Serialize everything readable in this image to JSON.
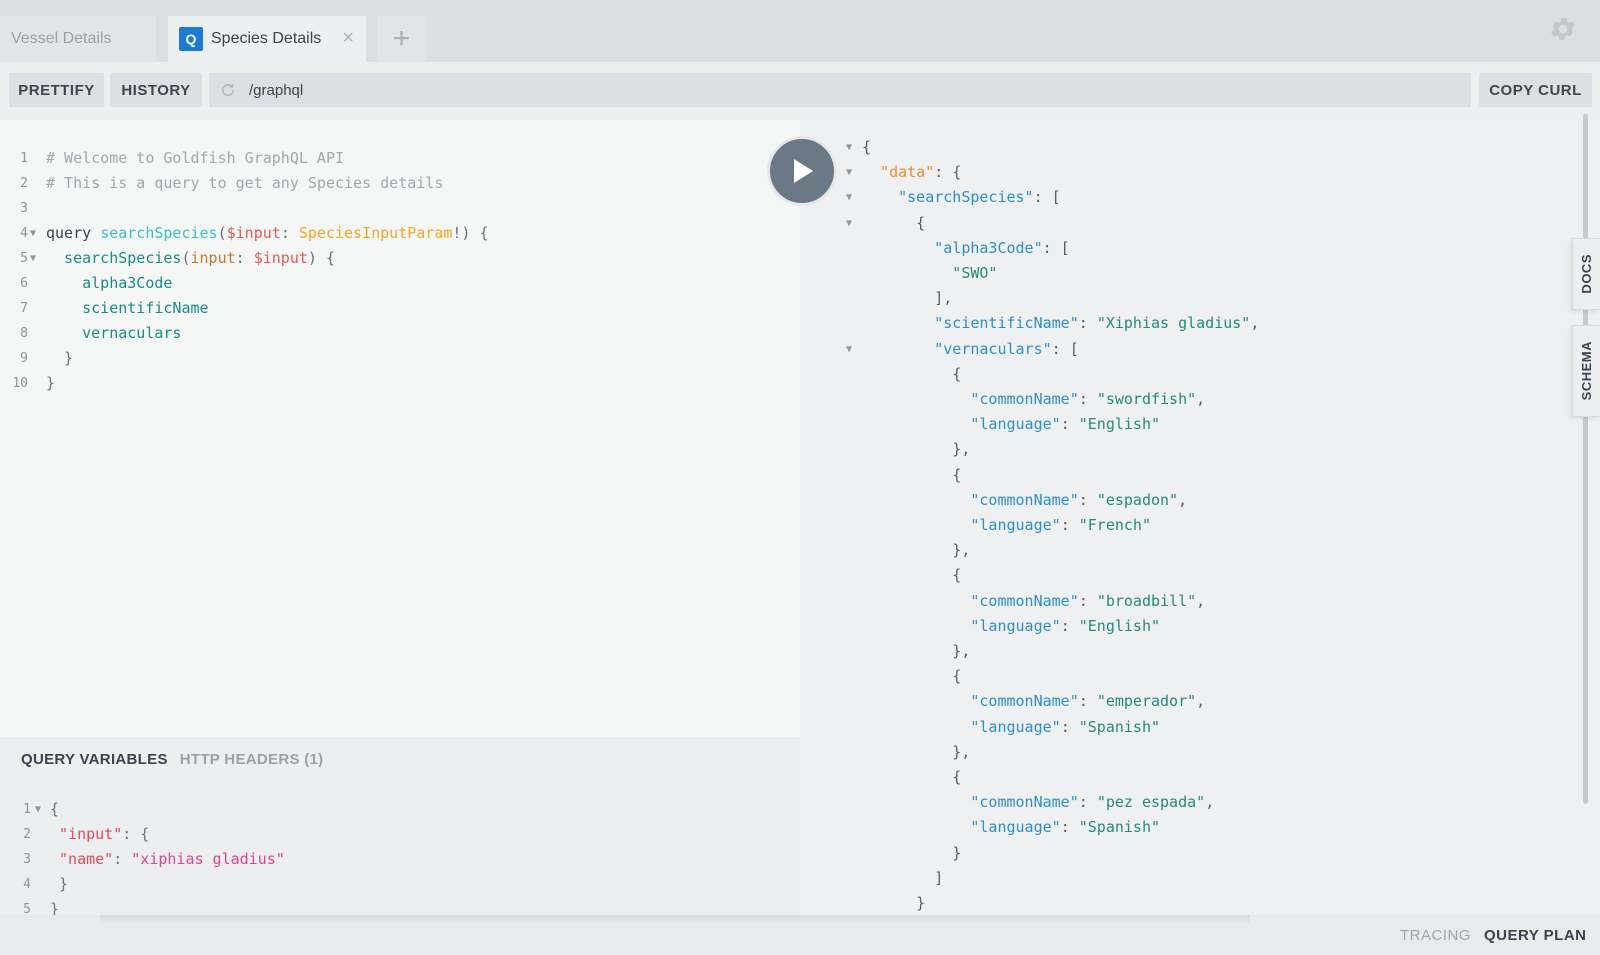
{
  "tabs": [
    {
      "label": "Vessel Details",
      "active": false
    },
    {
      "label": "Species Details",
      "active": true,
      "icon_letter": "Q"
    }
  ],
  "toolbar": {
    "prettify": "PRETTIFY",
    "history": "HISTORY",
    "url": "/graphql",
    "copy_curl": "COPY CURL"
  },
  "query_lines": [
    [
      {
        "t": "# Welcome to Goldfish GraphQL API",
        "c": "c-comment"
      }
    ],
    [
      {
        "t": "# This is a query to get any Species details",
        "c": "c-comment"
      }
    ],
    [],
    [
      {
        "t": "query ",
        "c": "c-kw"
      },
      {
        "t": "searchSpecies",
        "c": "c-def"
      },
      {
        "t": "(",
        "c": "c-punc"
      },
      {
        "t": "$input",
        "c": "c-var"
      },
      {
        "t": ": ",
        "c": "c-punc"
      },
      {
        "t": "SpeciesInputParam",
        "c": "c-type"
      },
      {
        "t": "!) {",
        "c": "c-punc"
      }
    ],
    [
      {
        "t": "  searchSpecies",
        "c": "c-field"
      },
      {
        "t": "(",
        "c": "c-punc"
      },
      {
        "t": "input",
        "c": "c-attr"
      },
      {
        "t": ": ",
        "c": "c-punc"
      },
      {
        "t": "$input",
        "c": "c-var"
      },
      {
        "t": ") {",
        "c": "c-punc"
      }
    ],
    [
      {
        "t": "    alpha3Code",
        "c": "c-field"
      }
    ],
    [
      {
        "t": "    scientificName",
        "c": "c-field"
      }
    ],
    [
      {
        "t": "    vernaculars",
        "c": "c-field"
      }
    ],
    [
      {
        "t": "  }",
        "c": "c-punc"
      }
    ],
    [
      {
        "t": "}",
        "c": "c-punc"
      }
    ]
  ],
  "query_folds": [
    4,
    5
  ],
  "variables": {
    "tab_active": "QUERY VARIABLES",
    "tab_inactive": "HTTP HEADERS (1)",
    "lines": [
      [
        {
          "t": "{",
          "c": "c-punc"
        }
      ],
      [
        {
          "t": " \"input\"",
          "c": "c-jkey"
        },
        {
          "t": ": {",
          "c": "c-punc"
        }
      ],
      [
        {
          "t": " \"name\"",
          "c": "c-jkey"
        },
        {
          "t": ": ",
          "c": "c-punc"
        },
        {
          "t": "\"xiphias gladius\"",
          "c": "c-jstr"
        }
      ],
      [
        {
          "t": " }",
          "c": "c-punc"
        }
      ],
      [
        {
          "t": "}",
          "c": "c-punc"
        }
      ]
    ],
    "folds": [
      1
    ]
  },
  "result_lines": [
    [
      {
        "t": "{",
        "c": "r-punc"
      }
    ],
    [
      {
        "t": "  \"data\"",
        "c": "r-key-data"
      },
      {
        "t": ": {",
        "c": "r-punc"
      }
    ],
    [
      {
        "t": "    \"searchSpecies\"",
        "c": "r-key"
      },
      {
        "t": ": [",
        "c": "r-punc"
      }
    ],
    [
      {
        "t": "      {",
        "c": "r-punc"
      }
    ],
    [
      {
        "t": "        \"alpha3Code\"",
        "c": "r-key"
      },
      {
        "t": ": [",
        "c": "r-punc"
      }
    ],
    [
      {
        "t": "          \"SWO\"",
        "c": "r-str"
      }
    ],
    [
      {
        "t": "        ],",
        "c": "r-punc"
      }
    ],
    [
      {
        "t": "        \"scientificName\"",
        "c": "r-key"
      },
      {
        "t": ": ",
        "c": "r-punc"
      },
      {
        "t": "\"Xiphias gladius\"",
        "c": "r-str"
      },
      {
        "t": ",",
        "c": "r-punc"
      }
    ],
    [
      {
        "t": "        \"vernaculars\"",
        "c": "r-key"
      },
      {
        "t": ": [",
        "c": "r-punc"
      }
    ],
    [
      {
        "t": "          {",
        "c": "r-punc"
      }
    ],
    [
      {
        "t": "            \"commonName\"",
        "c": "r-key"
      },
      {
        "t": ": ",
        "c": "r-punc"
      },
      {
        "t": "\"swordfish\"",
        "c": "r-str"
      },
      {
        "t": ",",
        "c": "r-punc"
      }
    ],
    [
      {
        "t": "            \"language\"",
        "c": "r-key"
      },
      {
        "t": ": ",
        "c": "r-punc"
      },
      {
        "t": "\"English\"",
        "c": "r-str"
      }
    ],
    [
      {
        "t": "          },",
        "c": "r-punc"
      }
    ],
    [
      {
        "t": "          {",
        "c": "r-punc"
      }
    ],
    [
      {
        "t": "            \"commonName\"",
        "c": "r-key"
      },
      {
        "t": ": ",
        "c": "r-punc"
      },
      {
        "t": "\"espadon\"",
        "c": "r-str"
      },
      {
        "t": ",",
        "c": "r-punc"
      }
    ],
    [
      {
        "t": "            \"language\"",
        "c": "r-key"
      },
      {
        "t": ": ",
        "c": "r-punc"
      },
      {
        "t": "\"French\"",
        "c": "r-str"
      }
    ],
    [
      {
        "t": "          },",
        "c": "r-punc"
      }
    ],
    [
      {
        "t": "          {",
        "c": "r-punc"
      }
    ],
    [
      {
        "t": "            \"commonName\"",
        "c": "r-key"
      },
      {
        "t": ": ",
        "c": "r-punc"
      },
      {
        "t": "\"broadbill\"",
        "c": "r-str"
      },
      {
        "t": ",",
        "c": "r-punc"
      }
    ],
    [
      {
        "t": "            \"language\"",
        "c": "r-key"
      },
      {
        "t": ": ",
        "c": "r-punc"
      },
      {
        "t": "\"English\"",
        "c": "r-str"
      }
    ],
    [
      {
        "t": "          },",
        "c": "r-punc"
      }
    ],
    [
      {
        "t": "          {",
        "c": "r-punc"
      }
    ],
    [
      {
        "t": "            \"commonName\"",
        "c": "r-key"
      },
      {
        "t": ": ",
        "c": "r-punc"
      },
      {
        "t": "\"emperador\"",
        "c": "r-str"
      },
      {
        "t": ",",
        "c": "r-punc"
      }
    ],
    [
      {
        "t": "            \"language\"",
        "c": "r-key"
      },
      {
        "t": ": ",
        "c": "r-punc"
      },
      {
        "t": "\"Spanish\"",
        "c": "r-str"
      }
    ],
    [
      {
        "t": "          },",
        "c": "r-punc"
      }
    ],
    [
      {
        "t": "          {",
        "c": "r-punc"
      }
    ],
    [
      {
        "t": "            \"commonName\"",
        "c": "r-key"
      },
      {
        "t": ": ",
        "c": "r-punc"
      },
      {
        "t": "\"pez espada\"",
        "c": "r-str"
      },
      {
        "t": ",",
        "c": "r-punc"
      }
    ],
    [
      {
        "t": "            \"language\"",
        "c": "r-key"
      },
      {
        "t": ": ",
        "c": "r-punc"
      },
      {
        "t": "\"Spanish\"",
        "c": "r-str"
      }
    ],
    [
      {
        "t": "          }",
        "c": "r-punc"
      }
    ],
    [
      {
        "t": "        ]",
        "c": "r-punc"
      }
    ],
    [
      {
        "t": "      }",
        "c": "r-punc"
      }
    ]
  ],
  "result_folds": [
    1,
    2,
    3,
    4,
    9
  ],
  "side_tabs": {
    "docs": "DOCS",
    "schema": "SCHEMA"
  },
  "footer": {
    "tracing": "TRACING",
    "query_plan": "QUERY PLAN"
  },
  "icons": {
    "gear": "gear-icon",
    "play": "play-icon",
    "reload": "reload-icon",
    "close": "close-icon",
    "add": "plus-icon"
  }
}
